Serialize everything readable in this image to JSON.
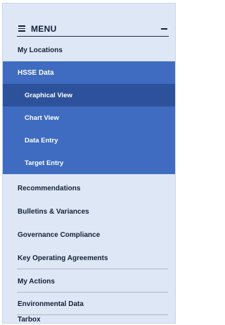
{
  "menu": {
    "title": "MENU",
    "menu_icon": "hamburger-icon",
    "collapse_icon": "minus-icon"
  },
  "items": {
    "my_locations": "My Locations",
    "hsse_data": "HSSE Data",
    "recommendations": "Recommendations",
    "bulletins": "Bulletins & Variances",
    "governance": "Governance Compliance",
    "key_agreements": "Key Operating Agreements",
    "my_actions": "My Actions",
    "environmental": "Environmental Data",
    "tarbox": "Tarbox"
  },
  "hsse_sub": {
    "graphical": "Graphical View",
    "chart": "Chart View",
    "data_entry": "Data Entry",
    "target_entry": "Target Entry"
  },
  "colors": {
    "sidebar_bg": "#dde7f6",
    "active_bg": "#3f6cc0",
    "selected_bg": "#2d529b",
    "text": "#142037"
  }
}
